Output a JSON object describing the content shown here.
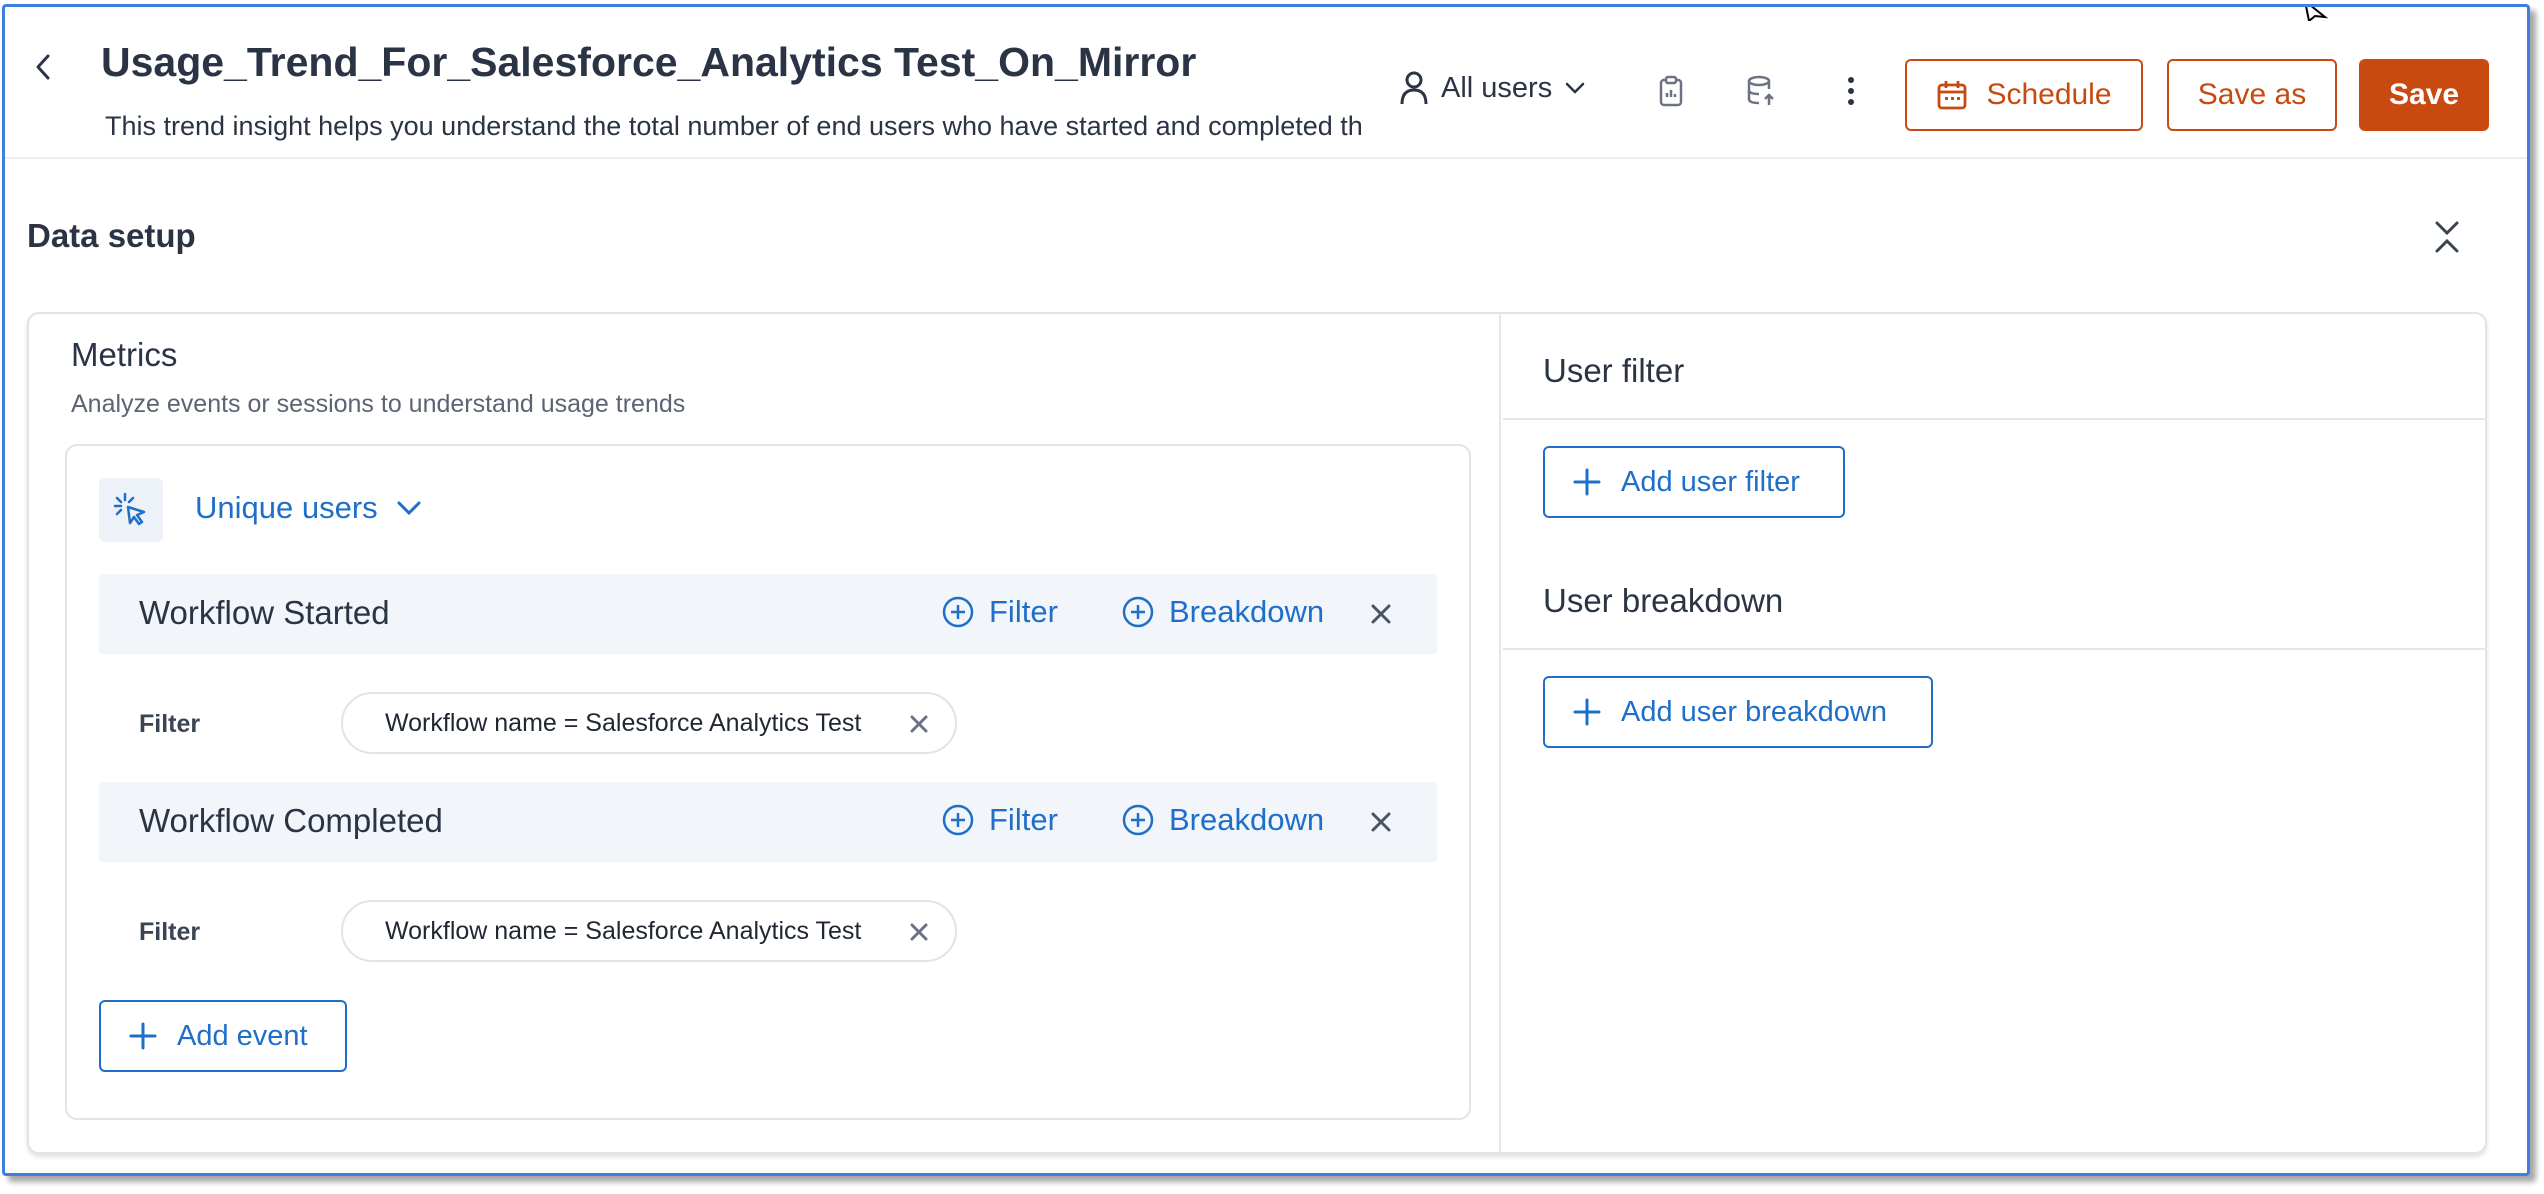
{
  "header": {
    "title": "Usage_Trend_For_Salesforce_Analytics Test_On_Mirror",
    "description": "This trend insight helps you understand the total number of end users who have started and completed the workflow",
    "users_select": "All users",
    "schedule_label": "Schedule",
    "save_as_label": "Save as",
    "save_label": "Save"
  },
  "data_setup": {
    "title": "Data setup",
    "metrics": {
      "title": "Metrics",
      "subtitle": "Analyze events or sessions to understand usage trends",
      "aggregation": "Unique users",
      "events": [
        {
          "name": "Workflow Started",
          "filter_action": "Filter",
          "breakdown_action": "Breakdown",
          "filter_label": "Filter",
          "filter_value": "Workflow name = Salesforce Analytics Test"
        },
        {
          "name": "Workflow Completed",
          "filter_action": "Filter",
          "breakdown_action": "Breakdown",
          "filter_label": "Filter",
          "filter_value": "Workflow name = Salesforce Analytics Test"
        }
      ],
      "add_event_label": "Add event"
    },
    "user_filter": {
      "title": "User filter",
      "add_label": "Add user filter"
    },
    "user_breakdown": {
      "title": "User breakdown",
      "add_label": "Add user breakdown"
    }
  },
  "colors": {
    "accent_blue": "#1f6fc9",
    "brand_orange": "#c84a10",
    "text_dark": "#2b3445"
  },
  "icons": [
    "back-icon",
    "user-icon",
    "chevron-down-icon",
    "clipboard-icon",
    "database-icon",
    "more-vert-icon",
    "calendar-icon",
    "collapse-icon",
    "cursor-click-icon",
    "plus-circle-icon",
    "close-icon",
    "plus-icon"
  ]
}
